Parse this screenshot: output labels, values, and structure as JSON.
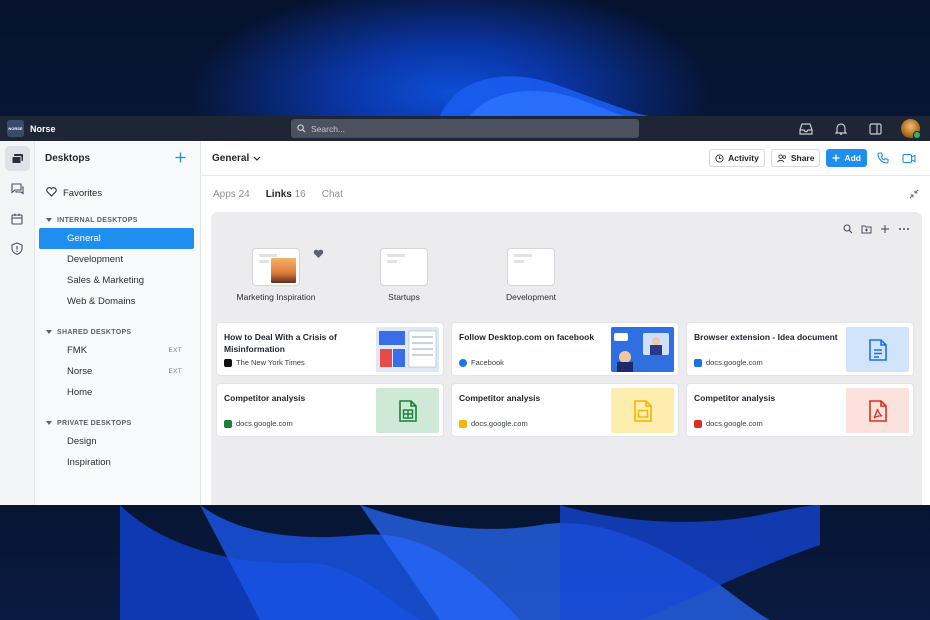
{
  "titlebar": {
    "brand_logo": "NORSE",
    "brand_name": "Norse",
    "search_placeholder": "Search..."
  },
  "sidebar": {
    "title": "Desktops",
    "favorites": "Favorites",
    "sections": [
      {
        "title": "INTERNAL DESKTOPS",
        "items": [
          {
            "label": "General"
          },
          {
            "label": "Development"
          },
          {
            "label": "Sales & Marketing"
          },
          {
            "label": "Web & Domains"
          }
        ]
      },
      {
        "title": "SHARED DESKTOPS",
        "items": [
          {
            "label": "FMK",
            "badge": "EXT"
          },
          {
            "label": "Norse",
            "badge": "EXT"
          },
          {
            "label": "Home"
          }
        ]
      },
      {
        "title": "PRIVATE DESKTOPS",
        "items": [
          {
            "label": "Design"
          },
          {
            "label": "Inspiration"
          }
        ]
      }
    ]
  },
  "topbar": {
    "breadcrumb": "General",
    "activity": "Activity",
    "share": "Share",
    "add": "Add"
  },
  "tabs": [
    {
      "label": "Apps",
      "count": "24"
    },
    {
      "label": "Links",
      "count": "16"
    },
    {
      "label": "Chat",
      "count": ""
    }
  ],
  "folders": [
    {
      "label": "Marketing Inspiration"
    },
    {
      "label": "Startups"
    },
    {
      "label": "Development"
    }
  ],
  "cards": [
    {
      "title": "How to Deal With a Crisis of Misinformation",
      "source": "The New York Times"
    },
    {
      "title": "Follow Desktop.com on facebook",
      "source": "Facebook"
    },
    {
      "title": "Browser extension - Idea document",
      "source": "docs.google.com"
    },
    {
      "title": "Competitor analysis",
      "source": "docs.google.com"
    },
    {
      "title": "Competitor analysis",
      "source": "docs.google.com"
    },
    {
      "title": "Competitor analysis",
      "source": "docs.google.com"
    }
  ],
  "colors": {
    "accent": "#1f8ef1",
    "titlebar": "#1e2635",
    "sheets": "#188038",
    "slides": "#f4b400",
    "pdf": "#d93025",
    "docs": "#1a73e8"
  }
}
